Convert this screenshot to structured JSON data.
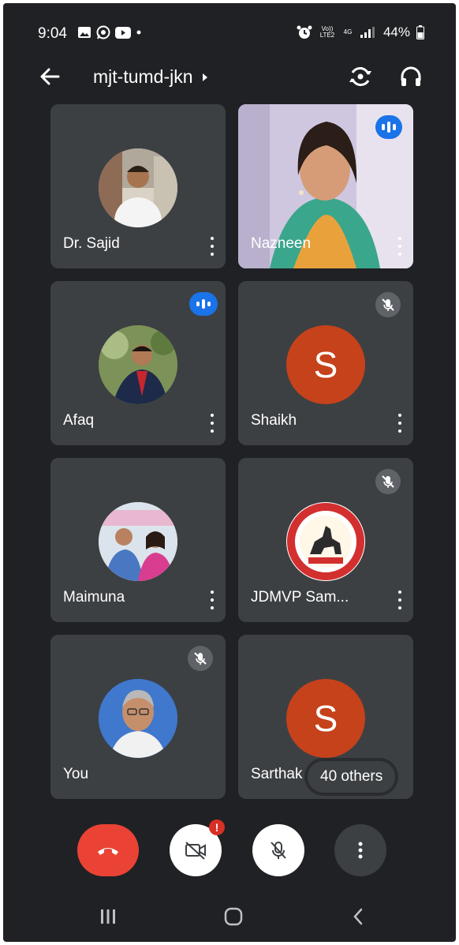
{
  "status_bar": {
    "time": "9:04",
    "volte_label": "Vo)) LTE2",
    "network_label": "4G",
    "battery": "44%"
  },
  "meeting": {
    "code": "mjt-tumd-jkn"
  },
  "participants": [
    {
      "name": "Dr. Sajid",
      "avatar": "photo",
      "state": "none"
    },
    {
      "name": "Nazneen",
      "avatar": "video",
      "state": "speaking"
    },
    {
      "name": "Afaq",
      "avatar": "photo",
      "state": "speaking"
    },
    {
      "name": "Shaikh",
      "avatar": "letter",
      "letter": "S",
      "state": "muted"
    },
    {
      "name": "Maimuna",
      "avatar": "photo",
      "state": "none"
    },
    {
      "name": "JDMVP Sam...",
      "avatar": "logo",
      "state": "muted"
    },
    {
      "name": "You",
      "avatar": "photo",
      "state": "muted"
    },
    {
      "name": "Sarthak",
      "avatar": "letter",
      "letter": "S",
      "state": "none"
    }
  ],
  "others_chip": "40 others",
  "controls": {
    "camera_alert": "!"
  },
  "colors": {
    "background": "#202124",
    "tile": "#3c4043",
    "speaking_blue": "#1a73e8",
    "end_call_red": "#ea4335",
    "letter_avatar": "#c5421b"
  }
}
